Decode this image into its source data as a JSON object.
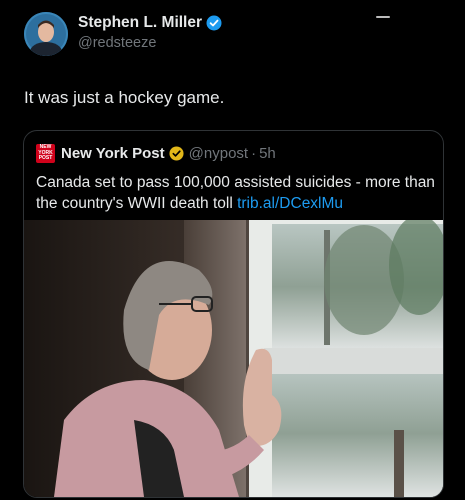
{
  "author": {
    "display_name": "Stephen L. Miller",
    "handle": "@redsteeze",
    "avatar": "avatar-photo",
    "verified_icon": "verified-badge-icon"
  },
  "tweet": {
    "text": "It was just a hockey game."
  },
  "quoted": {
    "logo_text": "NEW YORK POST",
    "display_name": "New York Post",
    "verified_icon": "gold-verified-badge-icon",
    "handle": "@nypost",
    "separator": "·",
    "time": "5h",
    "text": "Canada set to pass 100,000 assisted suicides - more than the country's WWII death toll ",
    "link": "trib.al/DCexlMu",
    "image": "photo-elderly-woman-at-window"
  },
  "colors": {
    "background": "#000000",
    "link": "#1d9bf0",
    "verified_blue": "#1d9bf0",
    "verified_gold": "#e2b719",
    "nypost_red": "#d0021b"
  }
}
